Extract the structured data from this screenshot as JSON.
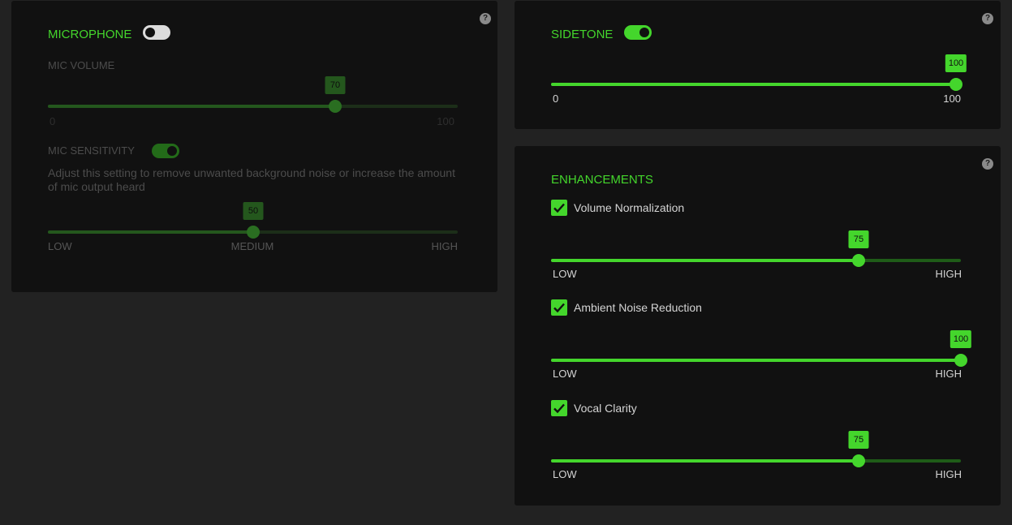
{
  "microphone": {
    "title": "MICROPHONE",
    "toggle_on": false,
    "mic_volume": {
      "label": "MIC VOLUME",
      "value": 70,
      "value_text": "70",
      "min_label": "0",
      "max_label": "100"
    },
    "mic_sensitivity": {
      "label": "MIC SENSITIVITY",
      "toggle_on": true,
      "description": "Adjust this setting to remove unwanted background noise or increase the amount of mic output heard",
      "value": 50,
      "value_text": "50",
      "low_label": "LOW",
      "medium_label": "MEDIUM",
      "high_label": "HIGH"
    },
    "help": "?"
  },
  "sidetone": {
    "title": "SIDETONE",
    "toggle_on": true,
    "value": 100,
    "value_text": "100",
    "min_label": "0",
    "max_label": "100",
    "help": "?"
  },
  "enhancements": {
    "title": "ENHANCEMENTS",
    "help": "?",
    "items": [
      {
        "label": "Volume Normalization",
        "checked": true,
        "value": 75,
        "value_text": "75",
        "low_label": "LOW",
        "high_label": "HIGH"
      },
      {
        "label": "Ambient Noise Reduction",
        "checked": true,
        "value": 100,
        "value_text": "100",
        "low_label": "LOW",
        "high_label": "HIGH"
      },
      {
        "label": "Vocal Clarity",
        "checked": true,
        "value": 75,
        "value_text": "75",
        "low_label": "LOW",
        "high_label": "HIGH"
      }
    ]
  },
  "colors": {
    "accent": "#44d62c",
    "panel": "#111111",
    "background": "#222222"
  }
}
